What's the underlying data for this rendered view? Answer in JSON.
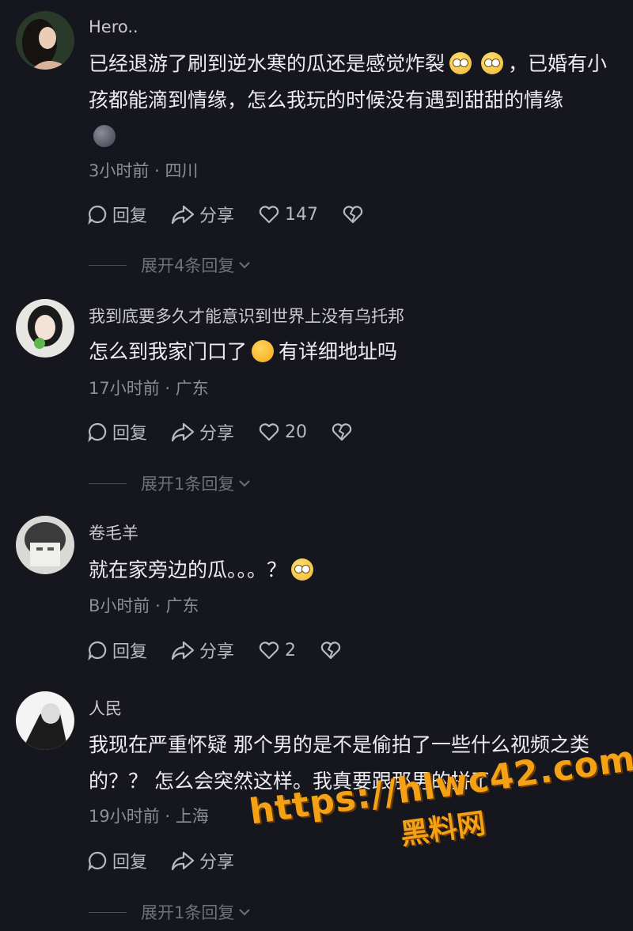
{
  "comments": [
    {
      "username": "Hero..",
      "text_part1": "已经退游了刷到逆水寒的瓜还是感觉炸裂",
      "text_part2": "，已婚有小孩都能滴到情缘，怎么我玩的时候没有遇到甜甜的情缘",
      "time": "3小时前",
      "location": "四川",
      "reply_label": "回复",
      "share_label": "分享",
      "likes": "147",
      "expand_label": "展开4条回复"
    },
    {
      "username": "我到底要多久才能意识到世界上没有乌托邦",
      "text_part1": "怎么到我家门口了",
      "text_part2": "有详细地址吗",
      "time": "17小时前",
      "location": "广东",
      "reply_label": "回复",
      "share_label": "分享",
      "likes": "20",
      "expand_label": "展开1条回复"
    },
    {
      "username": "卷毛羊",
      "text_part1": "就在家旁边的瓜。。。？",
      "time": "B小时前",
      "location": "广东",
      "reply_label": "回复",
      "share_label": "分享",
      "likes": "2"
    },
    {
      "username": "人民",
      "text_part1": "我现在严重怀疑 那个男的是不是偷拍了一些什么视频之类的？？ 怎么会突然这样。我真要跟那男的拼了",
      "time": "19小时前",
      "location": "上海",
      "reply_label": "回复",
      "share_label": "分享",
      "expand_label": "展开1条回复"
    }
  ],
  "meta_separator": "·",
  "watermark": {
    "url": "https://hlwc42.com",
    "site": "黑料网"
  },
  "icons": [
    "reply-icon",
    "share-icon",
    "heart-icon",
    "dislike-icon",
    "chevron-down-icon"
  ]
}
